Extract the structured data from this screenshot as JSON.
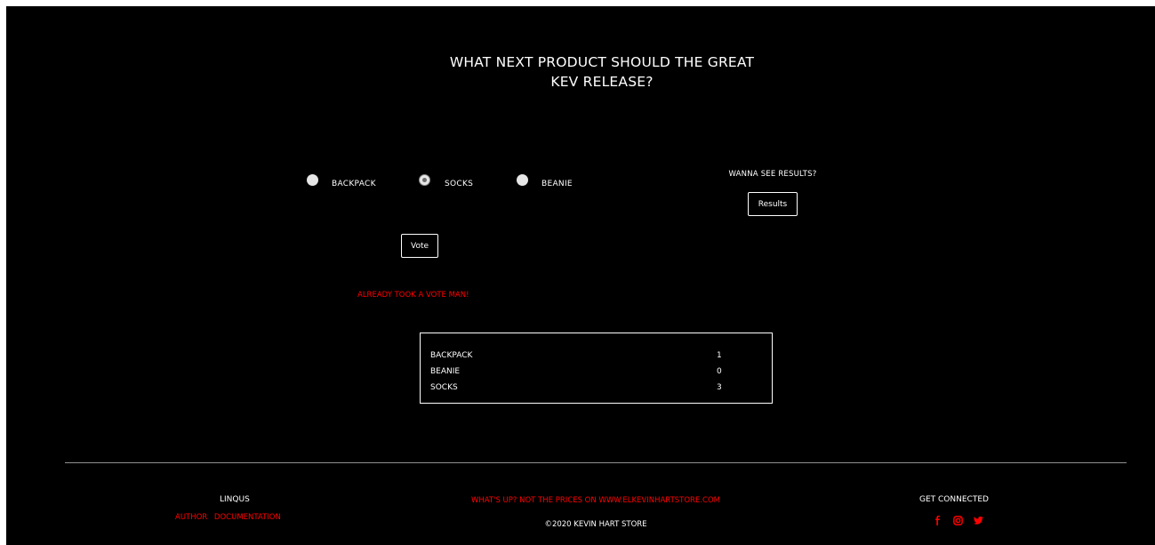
{
  "poll": {
    "title_line1": "WHAT NEXT PRODUCT SHOULD THE GREAT",
    "title_line2": "KEV RELEASE?",
    "options": [
      {
        "label": "BACKPACK",
        "checked": false
      },
      {
        "label": "SOCKS",
        "checked": true
      },
      {
        "label": "BEANIE",
        "checked": false
      }
    ],
    "vote_label": "Vote",
    "error_message": "ALREADY TOOK A VOTE MAN!"
  },
  "results": {
    "prompt": "WANNA SEE RESULTS?",
    "button_label": "Results",
    "rows": [
      {
        "name": "BACKPACK",
        "count": "1"
      },
      {
        "name": "BEANIE",
        "count": "0"
      },
      {
        "name": "SOCKS",
        "count": "3"
      }
    ]
  },
  "footer": {
    "links_heading": "LINQUS",
    "links": [
      "AUTHOR",
      "DOCUMENTATION"
    ],
    "tagline": "WHAT'S UP? NOT THE PRICES ON WWW.ELKEVINHARTSTORE.COM",
    "copyright": "©2020 KEVIN HART STORE",
    "social_heading": "GET CONNECTED",
    "social_icons": [
      "facebook-icon",
      "instagram-icon",
      "twitter-icon"
    ]
  },
  "colors": {
    "background": "#000000",
    "text": "#ffffff",
    "accent": "#ff0000"
  }
}
